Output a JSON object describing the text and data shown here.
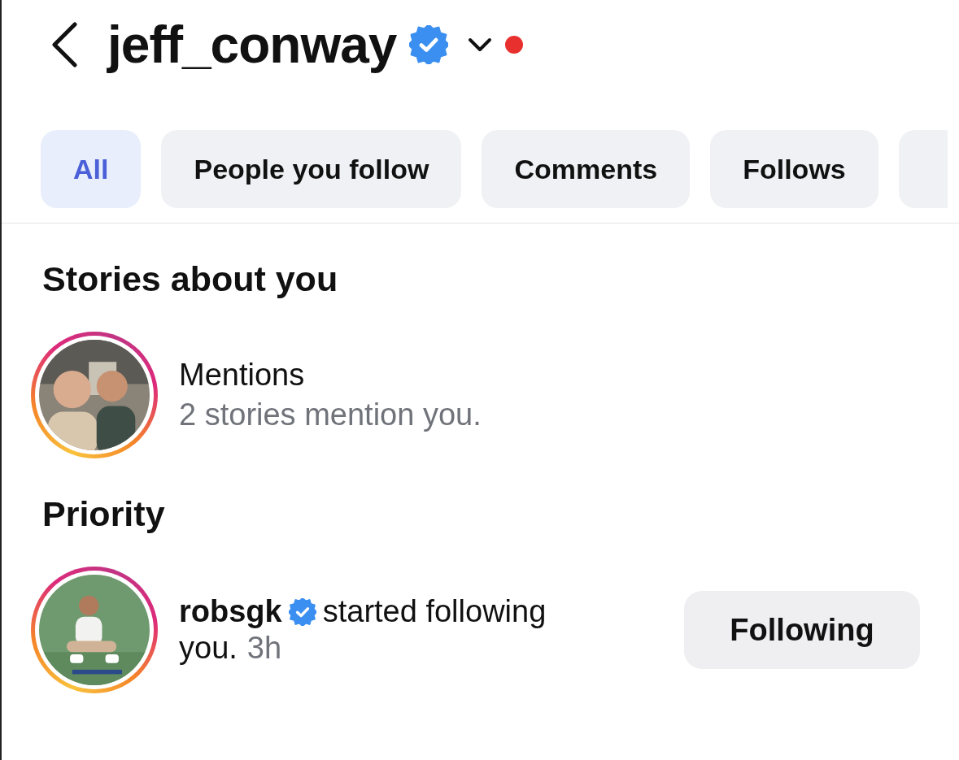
{
  "header": {
    "title": "jeff_conway",
    "verified": true,
    "unread_dot": true
  },
  "filters": [
    {
      "label": "All",
      "selected": true
    },
    {
      "label": "People you follow",
      "selected": false
    },
    {
      "label": "Comments",
      "selected": false
    },
    {
      "label": "Follows",
      "selected": false
    }
  ],
  "sections": [
    {
      "title": "Stories about you",
      "items": [
        {
          "kind": "mentions",
          "title": "Mentions",
          "subtitle": "2 stories mention you."
        }
      ]
    },
    {
      "title": "Priority",
      "items": [
        {
          "kind": "follow",
          "username": "robsgk",
          "verified": true,
          "text_lines": [
            "started following",
            "you."
          ],
          "time": "3h",
          "button": "Following"
        }
      ]
    }
  ]
}
